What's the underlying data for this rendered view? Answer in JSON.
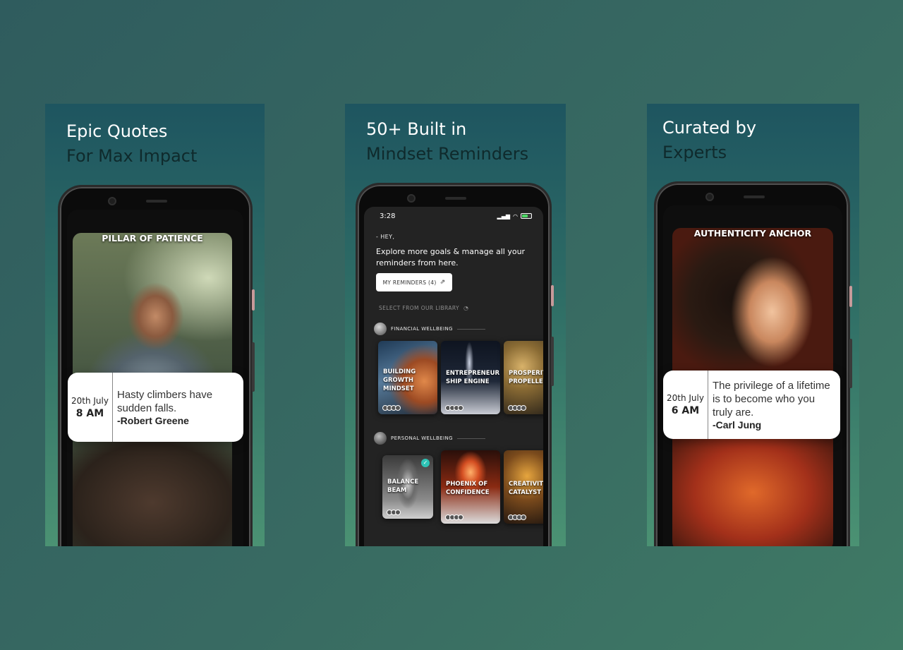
{
  "panels": [
    {
      "heading_line1": "Epic Quotes",
      "heading_line2": "For Max Impact",
      "photo_title": "PILLAR OF PATIENCE",
      "quote": {
        "date": "20th July",
        "time": "8 AM",
        "text": "Hasty climbers have sudden falls.",
        "author": "-Robert Greene"
      }
    },
    {
      "heading_line1": "50+ Built in",
      "heading_line2": "Mindset Reminders",
      "status_time": "3:28",
      "greeting": "- HEY,",
      "intro": "Explore more goals & manage all your reminders from here.",
      "my_reminders_button": "MY REMINDERS (4)",
      "library_label": "SELECT FROM OUR LIBRARY",
      "categories": [
        {
          "name": "FINANCIAL WELLBEING",
          "cards": [
            "BUILDING GROWTH MINDSET",
            "ENTREPRENEUR SHIP ENGINE",
            "PROSPERITY PROPELLER"
          ]
        },
        {
          "name": "PERSONAL WELLBEING",
          "cards": [
            "BALANCE BEAM",
            "PHOENIX OF CONFIDENCE",
            "CREATIVITY CATALYST"
          ]
        }
      ]
    },
    {
      "heading_line1": "Curated by",
      "heading_line2": "Experts",
      "photo_title": "AUTHENTICITY ANCHOR",
      "quote": {
        "date": "20th July",
        "time": "6 AM",
        "text": "The privilege of a lifetime is to become who you truly are.",
        "author": "-Carl Jung"
      }
    }
  ],
  "colors": {
    "background": "#356461",
    "panel_top": "#1e5560",
    "panel_bottom": "#4b9273",
    "heading_white": "#ffffff",
    "heading_dark": "#0f2a2c",
    "app_screen": "#222222"
  },
  "icons": [
    "external-link-icon",
    "wifi-icon",
    "signal-icon",
    "battery-icon",
    "check-icon",
    "eye-icon"
  ]
}
